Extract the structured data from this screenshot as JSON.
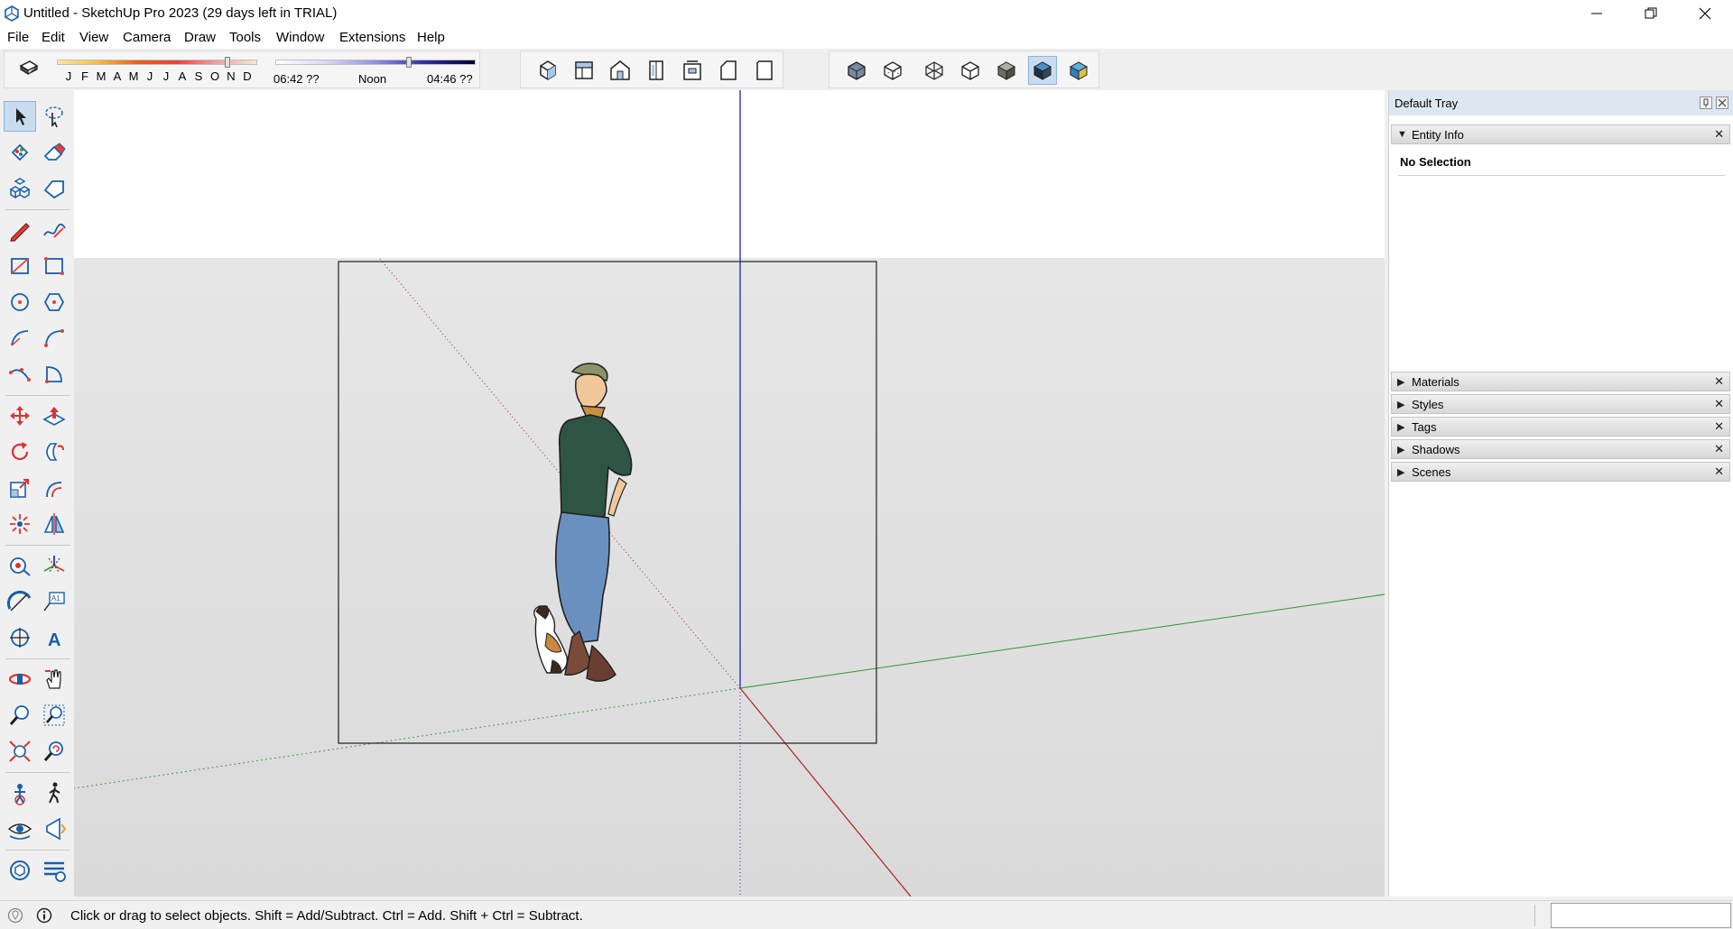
{
  "window": {
    "title": "Untitled - SketchUp Pro 2023 (29 days left in TRIAL)",
    "controls": [
      "minimize",
      "restore",
      "close"
    ]
  },
  "menu": [
    "File",
    "Edit",
    "View",
    "Camera",
    "Draw",
    "Tools",
    "Window",
    "Extensions",
    "Help"
  ],
  "shadow_settings": {
    "months": [
      "J",
      "F",
      "M",
      "A",
      "M",
      "J",
      "J",
      "A",
      "S",
      "O",
      "N",
      "D"
    ],
    "sunrise": "06:42 ??",
    "noon": "Noon",
    "sunset": "04:46 ??"
  },
  "views_toolbar": {
    "icons": [
      "iso-view-icon",
      "top-view-icon",
      "front-view-icon",
      "right-view-icon",
      "back-view-icon",
      "left-view-icon",
      "bottom-view-icon"
    ]
  },
  "style_toolbar": {
    "icons": [
      "xray-icon",
      "back-edges-icon",
      "wireframe-icon",
      "hidden-line-icon",
      "shaded-icon",
      "shaded-with-textures-icon",
      "monochrome-icon"
    ],
    "active": "shaded-with-textures-icon"
  },
  "tray": {
    "title": "Default Tray",
    "entity_info": {
      "label": "Entity Info",
      "selection": "No Selection"
    },
    "panels": [
      "Materials",
      "Styles",
      "Tags",
      "Shadows",
      "Scenes"
    ]
  },
  "status": {
    "message": "Click or drag to select objects. Shift = Add/Subtract. Ctrl = Add. Shift + Ctrl = Subtract.",
    "measurements_value": ""
  },
  "colors": {
    "sky": "#ffffff",
    "ground": "#e2e2e2",
    "axis_red": "#cc3030",
    "axis_green": "#40a040",
    "axis_blue": "#3030c0",
    "tray_header": "#dde7f2"
  }
}
